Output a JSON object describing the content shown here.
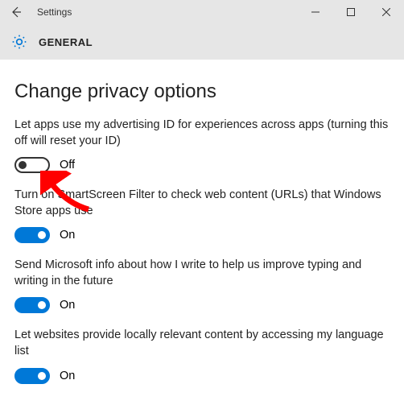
{
  "window": {
    "title": "Settings"
  },
  "section": {
    "title": "GENERAL"
  },
  "page": {
    "title": "Change privacy options"
  },
  "settings": [
    {
      "description": "Let apps use my advertising ID for experiences across apps (turning this off will reset your ID)",
      "state_label": "Off",
      "on": false
    },
    {
      "description": "Turn on SmartScreen Filter to check web content (URLs) that Windows Store apps use",
      "state_label": "On",
      "on": true
    },
    {
      "description": "Send Microsoft info about how I write to help us improve typing and writing in the future",
      "state_label": "On",
      "on": true
    },
    {
      "description": "Let websites provide locally relevant content by accessing my language list",
      "state_label": "On",
      "on": true
    }
  ],
  "colors": {
    "accent": "#0078d7",
    "titlebar_bg": "#e6e6e6",
    "annotation_arrow": "#ff0000"
  },
  "annotation": {
    "type": "arrow",
    "target": "advertising-id-toggle"
  }
}
